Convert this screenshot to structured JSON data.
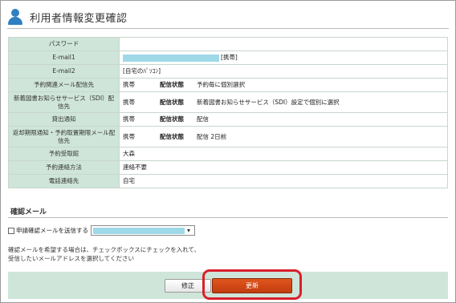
{
  "header": {
    "title": "利用者情報変更確認",
    "icon": "user-icon"
  },
  "rows": [
    {
      "label": "パスワード",
      "value": ""
    },
    {
      "label": "E-mail1",
      "value": "[携帯]"
    },
    {
      "label": "E-mail2",
      "value": "[自宅のﾊﾟｿｺﾝ]"
    },
    {
      "label": "予約関連メール配信先",
      "col1": "携帯",
      "col2": "配信状態",
      "col3": "予約毎に個別選択"
    },
    {
      "label": "新着図書お知らせサービス（SDI）配信先",
      "col1": "携帯",
      "col2": "配信状態",
      "col3": "新着図書お知らせサービス（SDI）設定で個別に選択"
    },
    {
      "label": "貸出通知",
      "col1": "携帯",
      "col2": "配信状態",
      "col3": "配信"
    },
    {
      "label": "返却期限通知・予約取置期限メール配信先",
      "col1": "携帯",
      "col2": "配信状態",
      "col3": "配信 2日前"
    },
    {
      "label": "予約受取館",
      "value": "大森"
    },
    {
      "label": "予約連絡方法",
      "value": "連絡不要"
    },
    {
      "label": "電話連絡先",
      "value": "自宅"
    }
  ],
  "confirm": {
    "section_title": "確認メール",
    "checkbox_label": "申請確認メールを送信する",
    "checked": false,
    "note_line1": "確認メールを希望する場合は、チェックボックスにチェックを入れて、",
    "note_line2": "受信したいメールアドレスを選択してください"
  },
  "buttons": {
    "fix": "修正",
    "update": "更新"
  },
  "colors": {
    "label_bg": "#cfe5da",
    "update_btn": "#d24a16",
    "highlight": "#d9202a",
    "redacted": "#9fd9e8"
  }
}
